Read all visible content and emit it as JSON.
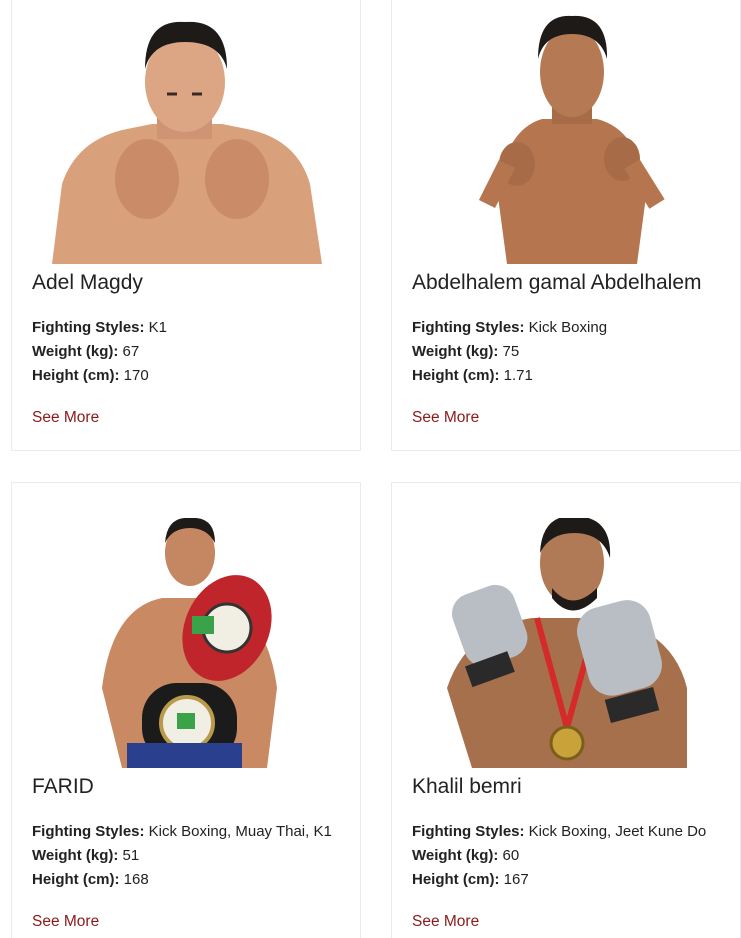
{
  "fighters": [
    {
      "name": "Adel Magdy",
      "styles_label": "Fighting Styles:",
      "styles": "K1",
      "weight_label": "Weight (kg):",
      "weight": "67",
      "height_label": "Height (cm):",
      "height": "170",
      "link": "See More"
    },
    {
      "name": "Abdelhalem gamal Abdelhalem",
      "styles_label": "Fighting Styles:",
      "styles": "Kick Boxing",
      "weight_label": "Weight (kg):",
      "weight": "75",
      "height_label": "Height (cm):",
      "height": "1.71",
      "link": "See More"
    },
    {
      "name": "FARID",
      "styles_label": "Fighting Styles:",
      "styles": "Kick Boxing, Muay Thai, K1",
      "weight_label": "Weight (kg):",
      "weight": "51",
      "height_label": "Height (cm):",
      "height": "168",
      "link": "See More"
    },
    {
      "name": "Khalil bemri",
      "styles_label": "Fighting Styles:",
      "styles": "Kick Boxing, Jeet Kune Do",
      "weight_label": "Weight (kg):",
      "weight": "60",
      "height_label": "Height (cm):",
      "height": "167",
      "link": "See More"
    }
  ],
  "colors": {
    "link": "#8b1a1a",
    "card_border": "#e9ecef",
    "skin": "#d9a07c",
    "hair": "#1e1a18"
  }
}
